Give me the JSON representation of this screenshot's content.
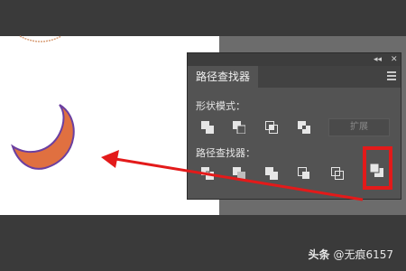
{
  "panel": {
    "title": "路径查找器",
    "collapse_glyph": "◂◂",
    "close_glyph": "✕",
    "shape_modes_label": "形状模式：",
    "expand_label": "扩展",
    "pathfinders_label": "路径查找器："
  },
  "icons": {
    "shape_modes": [
      "unite-icon",
      "minus-front-icon",
      "intersect-icon",
      "exclude-icon"
    ],
    "pathfinders": [
      "divide-icon",
      "trim-icon",
      "merge-icon",
      "crop-icon",
      "outline-icon",
      "minus-back-icon"
    ]
  },
  "colors": {
    "moon_fill": "#e07040",
    "moon_stroke": "#6b3fa0",
    "arrow": "#e31a1a"
  },
  "watermark": {
    "platform": "头条",
    "user": "@无痕6157"
  }
}
